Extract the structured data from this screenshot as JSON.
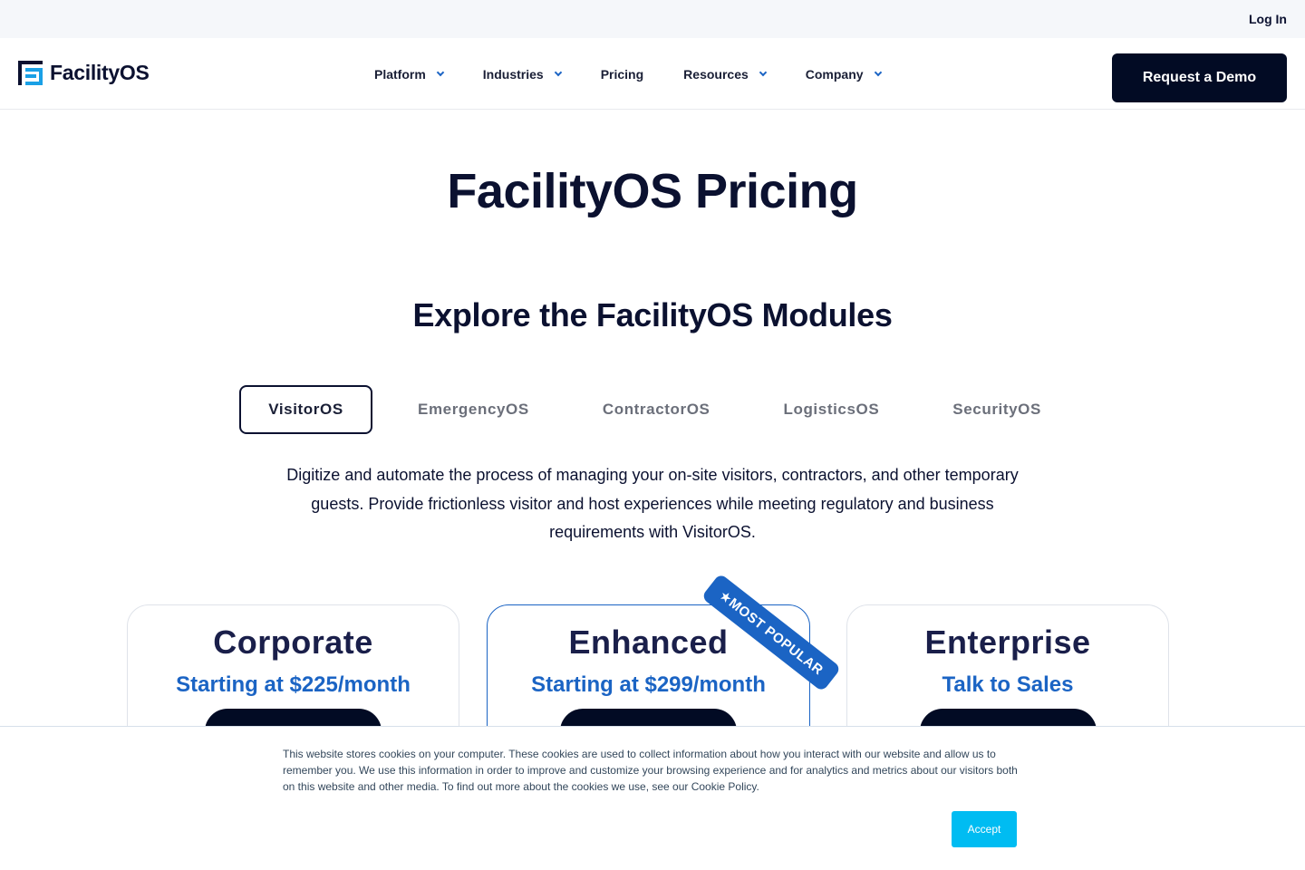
{
  "topbar": {
    "login_label": "Log In"
  },
  "brand": {
    "name": "FacilityOS"
  },
  "nav": {
    "items": [
      {
        "label": "Platform",
        "has_dropdown": true
      },
      {
        "label": "Industries",
        "has_dropdown": true
      },
      {
        "label": "Pricing",
        "has_dropdown": false
      },
      {
        "label": "Resources",
        "has_dropdown": true
      },
      {
        "label": "Company",
        "has_dropdown": true
      }
    ],
    "cta_label": "Request a Demo"
  },
  "hero": {
    "title": "FacilityOS Pricing",
    "subtitle": "Explore the FacilityOS Modules"
  },
  "modules": {
    "tabs": [
      {
        "label": "VisitorOS",
        "active": true
      },
      {
        "label": "EmergencyOS",
        "active": false
      },
      {
        "label": "ContractorOS",
        "active": false
      },
      {
        "label": "LogisticsOS",
        "active": false
      },
      {
        "label": "SecurityOS",
        "active": false
      }
    ],
    "description": "Digitize and automate the process of managing your on-site visitors, contractors, and other temporary guests. Provide frictionless visitor and host experiences while meeting regulatory and business requirements with VisitorOS."
  },
  "plans": [
    {
      "name": "Corporate",
      "price": "Starting at $225/month",
      "featured": false
    },
    {
      "name": "Enhanced",
      "price": "Starting at $299/month",
      "featured": true,
      "badge": "★MOST POPULAR"
    },
    {
      "name": "Enterprise",
      "price": "Talk to Sales",
      "featured": false
    }
  ],
  "cookie_banner": {
    "text": "This website stores cookies on your computer. These cookies are used to collect information about how you interact with our website and allow us to remember you. We use this information in order to improve and customize your browsing experience and for analytics and metrics about our visitors both on this website and other media. To find out more about the cookies we use, see our Cookie Policy.",
    "accept_label": "Accept"
  },
  "colors": {
    "navy": "#0b1130",
    "button_dark": "#020b24",
    "accent_blue": "#1b64c4",
    "logo_blue": "#1aa0e6",
    "accept_cyan": "#00bcf2"
  }
}
